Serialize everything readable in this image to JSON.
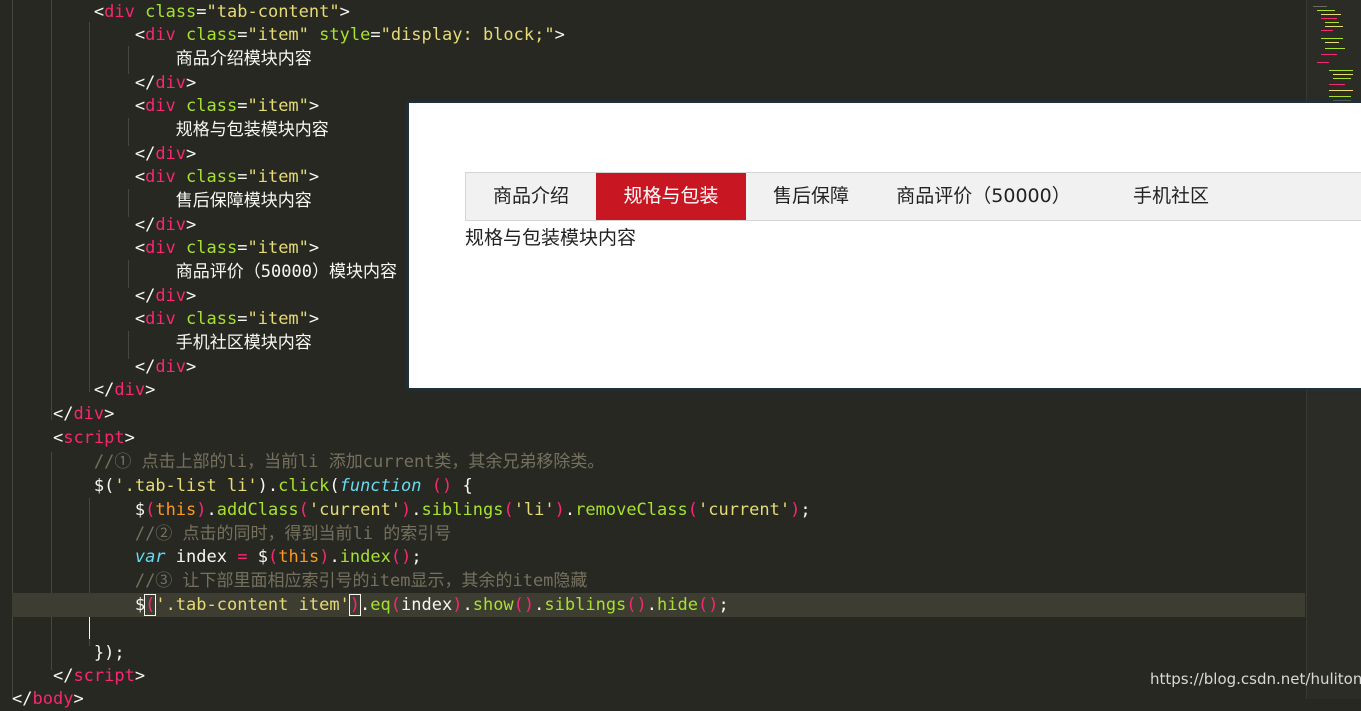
{
  "editor": {
    "lines": {
      "l1_tag": "div",
      "l1_attr": "class",
      "l1_val": "\"tab-content\"",
      "l2_tag": "div",
      "l2_attr1": "class",
      "l2_val1": "\"item\"",
      "l2_attr2": "style",
      "l2_val2": "\"display: block;\"",
      "l3_text": "商品介绍模块内容",
      "l4_tag": "div",
      "l5_tag": "div",
      "l5_attr": "class",
      "l5_val": "\"item\"",
      "l6_text": "规格与包装模块内容",
      "l7_tag": "div",
      "l8_tag": "div",
      "l8_attr": "class",
      "l8_val": "\"item\"",
      "l9_text": "售后保障模块内容",
      "l10_tag": "div",
      "l11_tag": "div",
      "l11_attr": "class",
      "l11_val": "\"item\"",
      "l12_text": "商品评价（50000）模块内容",
      "l13_tag": "div",
      "l14_tag": "div",
      "l14_attr": "class",
      "l14_val": "\"item\"",
      "l15_text": "手机社区模块内容",
      "l16_tag": "div",
      "l17_tag": "div",
      "l18_tag": "div",
      "l19_tag": "script",
      "l20_comment": "//① 点击上部的li，当前li 添加current类，其余兄弟移除类。",
      "l21_sel": "'.tab-list li'",
      "l21_method": "click",
      "l21_kw": "function",
      "l22_this": "this",
      "l22_m1": "addClass",
      "l22_s1": "'current'",
      "l22_m2": "siblings",
      "l22_s2": "'li'",
      "l22_m3": "removeClass",
      "l22_s3": "'current'",
      "l23_comment": "//② 点击的同时，得到当前li 的索引号",
      "l24_kw": "var",
      "l24_var": "index",
      "l24_this": "this",
      "l24_m": "index",
      "l25_comment": "//③ 让下部里面相应索引号的item显示，其余的item隐藏",
      "l26_sel": "'.tab-content item'",
      "l26_m1": "eq",
      "l26_arg": "index",
      "l26_m2": "show",
      "l26_m3": "siblings",
      "l26_m4": "hide",
      "l28_close": "});",
      "l29_tag": "script",
      "l30_tag": "body"
    }
  },
  "preview": {
    "tabs": [
      "商品介绍",
      "规格与包装",
      "售后保障",
      "商品评价（50000）",
      "手机社区"
    ],
    "current_index": 1,
    "content_text": "规格与包装模块内容"
  },
  "watermark": "https://blog.csdn.net/hulitong",
  "colors": {
    "editor_bg": "#272822",
    "tab_active": "#c81623",
    "tag": "#f92672",
    "attribute": "#a6e22e",
    "string": "#e6db74",
    "comment": "#75715e",
    "keyword": "#66d9ef",
    "this": "#fd971f"
  }
}
